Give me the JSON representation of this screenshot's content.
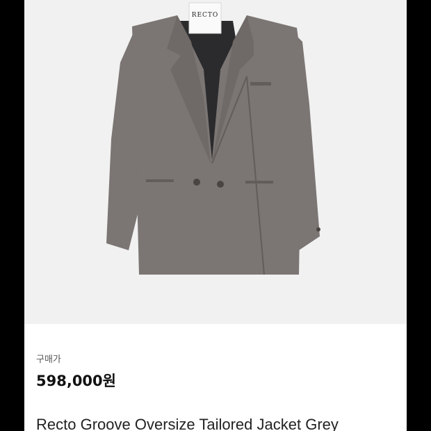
{
  "product": {
    "image_alt": "grey double-breasted oversize tailored jacket",
    "brand_label": "RECTO",
    "price_label": "구매가",
    "price": "598,000원",
    "title": "Recto Groove Oversize Tailored Jacket Grey"
  },
  "colors": {
    "jacket": "#7b7573",
    "jacket_shadow": "#625c5a",
    "lining": "#2b2b2d",
    "background": "#f1f1f1",
    "frame": "#000000"
  }
}
